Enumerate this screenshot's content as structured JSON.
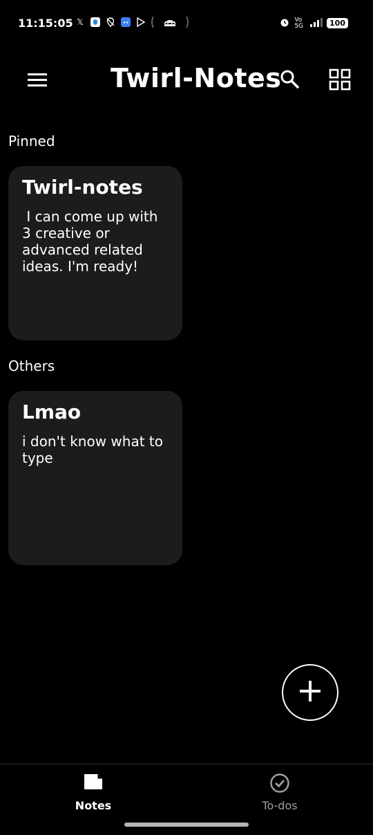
{
  "status_bar": {
    "time": "11:15:05",
    "battery": "100"
  },
  "app_bar": {
    "title": "Twirl-Notes"
  },
  "sections": {
    "pinned_label": "Pinned",
    "others_label": "Others"
  },
  "notes": {
    "pinned": [
      {
        "title": "Twirl-notes",
        "body": " I can come up with 3 creative or advanced related ideas. I'm ready!"
      }
    ],
    "others": [
      {
        "title": "Lmao",
        "body": "i don't know what to type"
      }
    ]
  },
  "bottom_nav": {
    "notes_label": "Notes",
    "todos_label": "To-dos"
  },
  "colors": {
    "background": "#000000",
    "card": "#1c1c1c",
    "inactive": "#9e9e9e"
  }
}
